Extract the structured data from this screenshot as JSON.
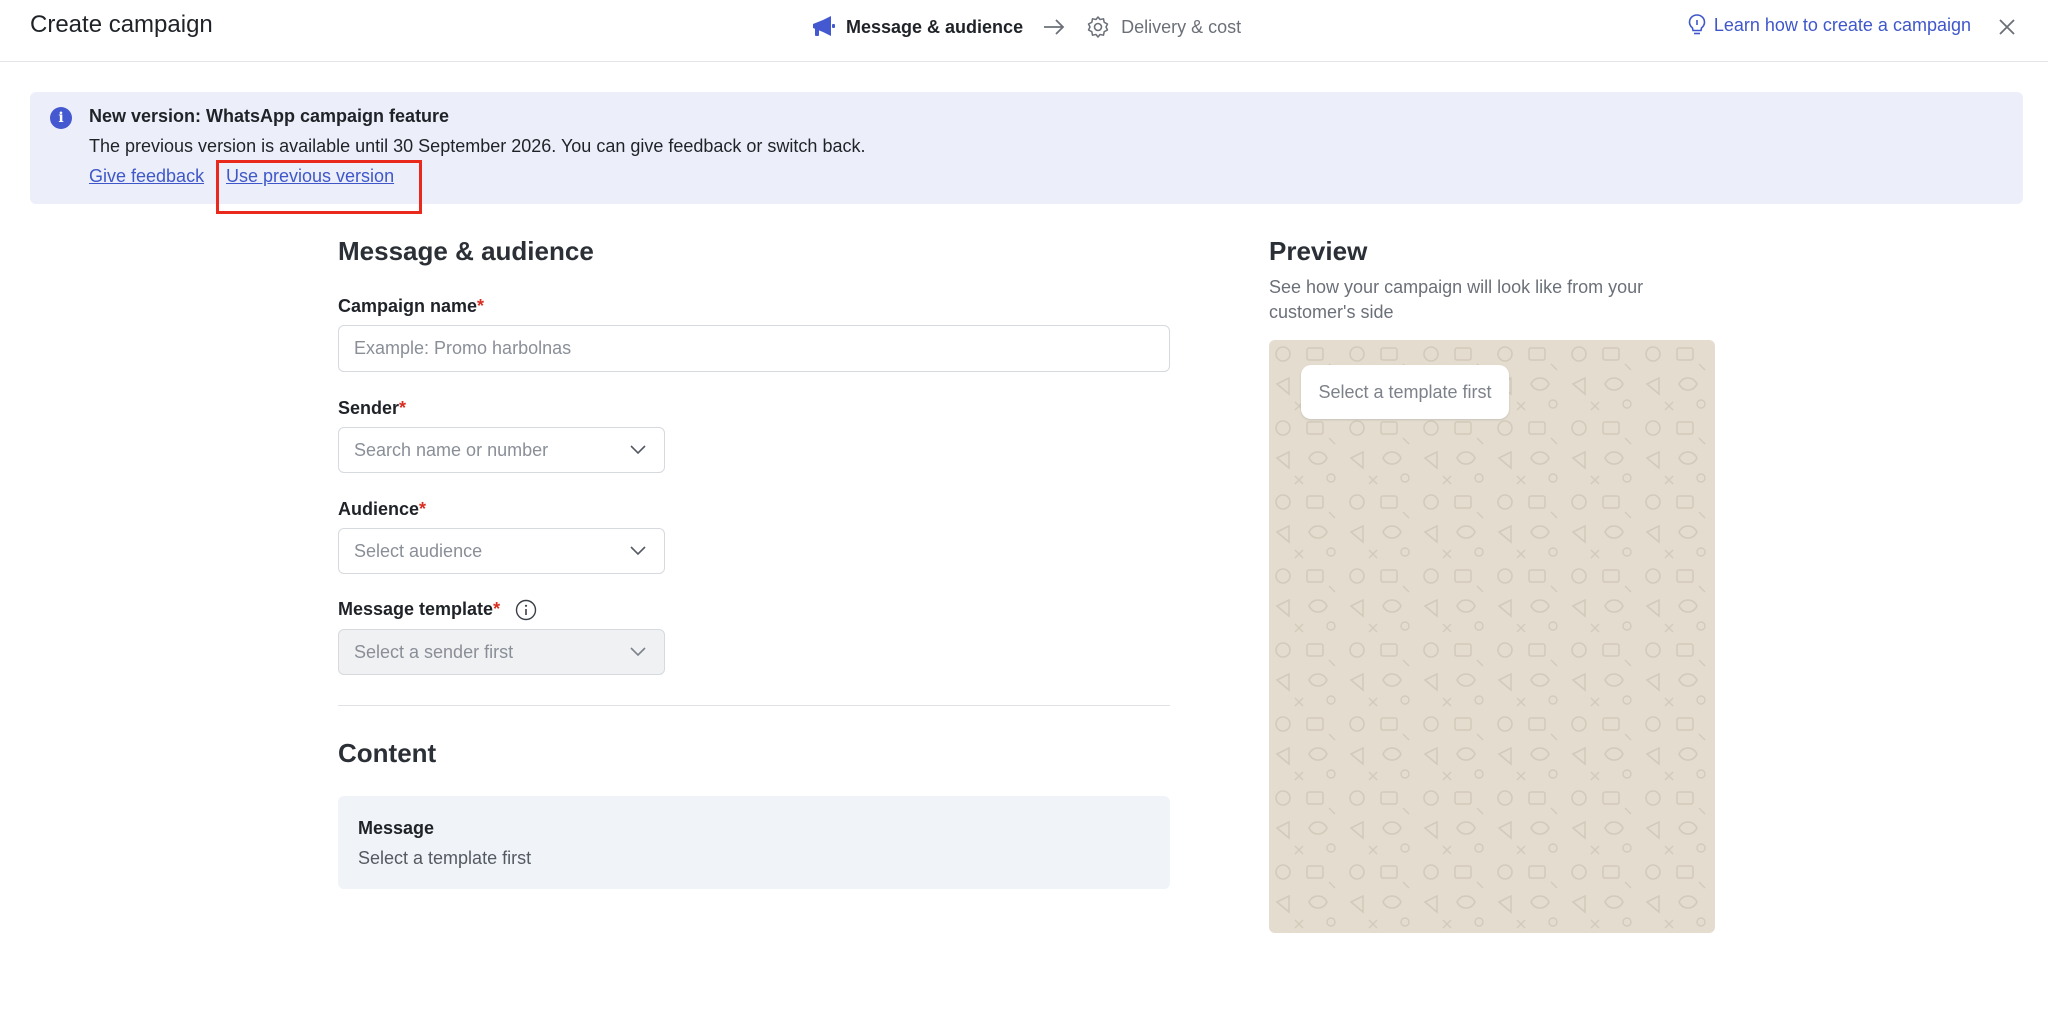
{
  "header": {
    "title": "Create campaign",
    "steps": [
      {
        "label": "Message & audience",
        "icon": "megaphone-icon",
        "active": true
      },
      {
        "label": "Delivery & cost",
        "icon": "gear-icon",
        "active": false
      }
    ],
    "learn_link": "Learn how to create a campaign",
    "close_icon": "close-icon"
  },
  "banner": {
    "title": "New version: WhatsApp campaign feature",
    "text": "The previous version is available until 30 September 2026. You can give feedback or switch back.",
    "feedback_link": "Give feedback",
    "previous_link": "Use previous version"
  },
  "form": {
    "section_title": "Message & audience",
    "campaign_name": {
      "label": "Campaign name",
      "required_mark": "*",
      "placeholder": "Example: Promo harbolnas"
    },
    "sender": {
      "label": "Sender",
      "required_mark": "*",
      "placeholder": "Search name or number"
    },
    "audience": {
      "label": "Audience",
      "required_mark": "*",
      "placeholder": "Select audience"
    },
    "template": {
      "label": "Message template",
      "required_mark": "*",
      "placeholder": "Select a sender first"
    }
  },
  "content": {
    "section_title": "Content",
    "message_title": "Message",
    "message_text": "Select a template first"
  },
  "preview": {
    "title": "Preview",
    "subtitle": "See how your campaign will look like from your customer's side",
    "bubble_text": "Select a template first"
  },
  "colors": {
    "accent": "#3f57c9",
    "required": "#d92d20",
    "banner_bg": "#eceff9",
    "highlight": "#e8291c",
    "chat_bg": "#e3dccf"
  }
}
